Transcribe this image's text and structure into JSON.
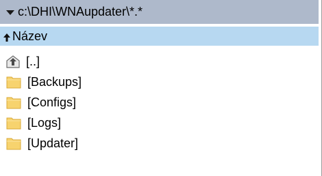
{
  "path_bar": {
    "path": "c:\\DHI\\WNAupdater\\*.*"
  },
  "column_header": {
    "name_label": "Název"
  },
  "files": [
    {
      "name": "[..]",
      "icon": "parent-folder-icon"
    },
    {
      "name": "[Backups]",
      "icon": "folder-icon"
    },
    {
      "name": "[Configs]",
      "icon": "folder-icon"
    },
    {
      "name": "[Logs]",
      "icon": "folder-icon"
    },
    {
      "name": "[Updater]",
      "icon": "folder-icon"
    }
  ],
  "colors": {
    "path_bar_bg": "#aeb9cb",
    "header_bg": "#b7d8f1",
    "folder_fill": "#f7d36e"
  }
}
